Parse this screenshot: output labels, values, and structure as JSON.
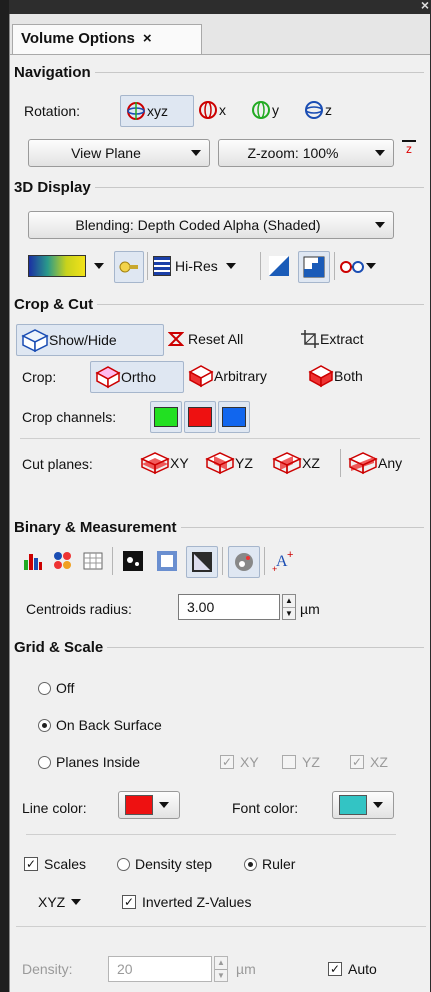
{
  "window": {
    "close_glyph": "×"
  },
  "tab": {
    "label": "Volume Options",
    "close": "×"
  },
  "navigation": {
    "title": "Navigation",
    "rotation_label": "Rotation:",
    "rotation_modes": [
      "xyz",
      "x",
      "y",
      "z"
    ],
    "view_plane": "View Plane",
    "zoom": "Z-zoom: 100%",
    "z_marker": "z"
  },
  "display": {
    "title": "3D Display",
    "blending": "Blending: Depth Coded Alpha (Shaded)",
    "hires": "Hi-Res"
  },
  "crop": {
    "title": "Crop & Cut",
    "show_hide": "Show/Hide",
    "reset_all": "Reset All",
    "extract": "Extract",
    "crop_label": "Crop:",
    "crop_modes": [
      "Ortho",
      "Arbitrary",
      "Both"
    ],
    "channels_label": "Crop channels:",
    "channel_colors": [
      "#22e022",
      "#ee1111",
      "#1166ee"
    ],
    "cut_label": "Cut planes:",
    "cut_planes": [
      "XY",
      "YZ",
      "XZ",
      "Any"
    ]
  },
  "binary": {
    "title": "Binary & Measurement",
    "centroids_label": "Centroids radius:",
    "centroids_value": "3.00",
    "unit": "µm"
  },
  "grid": {
    "title": "Grid & Scale",
    "options": [
      "Off",
      "On Back Surface",
      "Planes Inside"
    ],
    "selected": "On Back Surface",
    "planes": [
      {
        "label": "XY",
        "checked": true
      },
      {
        "label": "YZ",
        "checked": false
      },
      {
        "label": "XZ",
        "checked": true
      }
    ],
    "line_color_label": "Line color:",
    "line_color": "#ee1111",
    "font_color_label": "Font color:",
    "font_color": "#33c4c4",
    "scales": "Scales",
    "density_step": "Density step",
    "ruler": "Ruler",
    "axis": "XYZ",
    "inverted": "Inverted Z-Values",
    "density_label": "Density:",
    "density_value": "20",
    "density_unit": "µm",
    "auto": "Auto"
  }
}
